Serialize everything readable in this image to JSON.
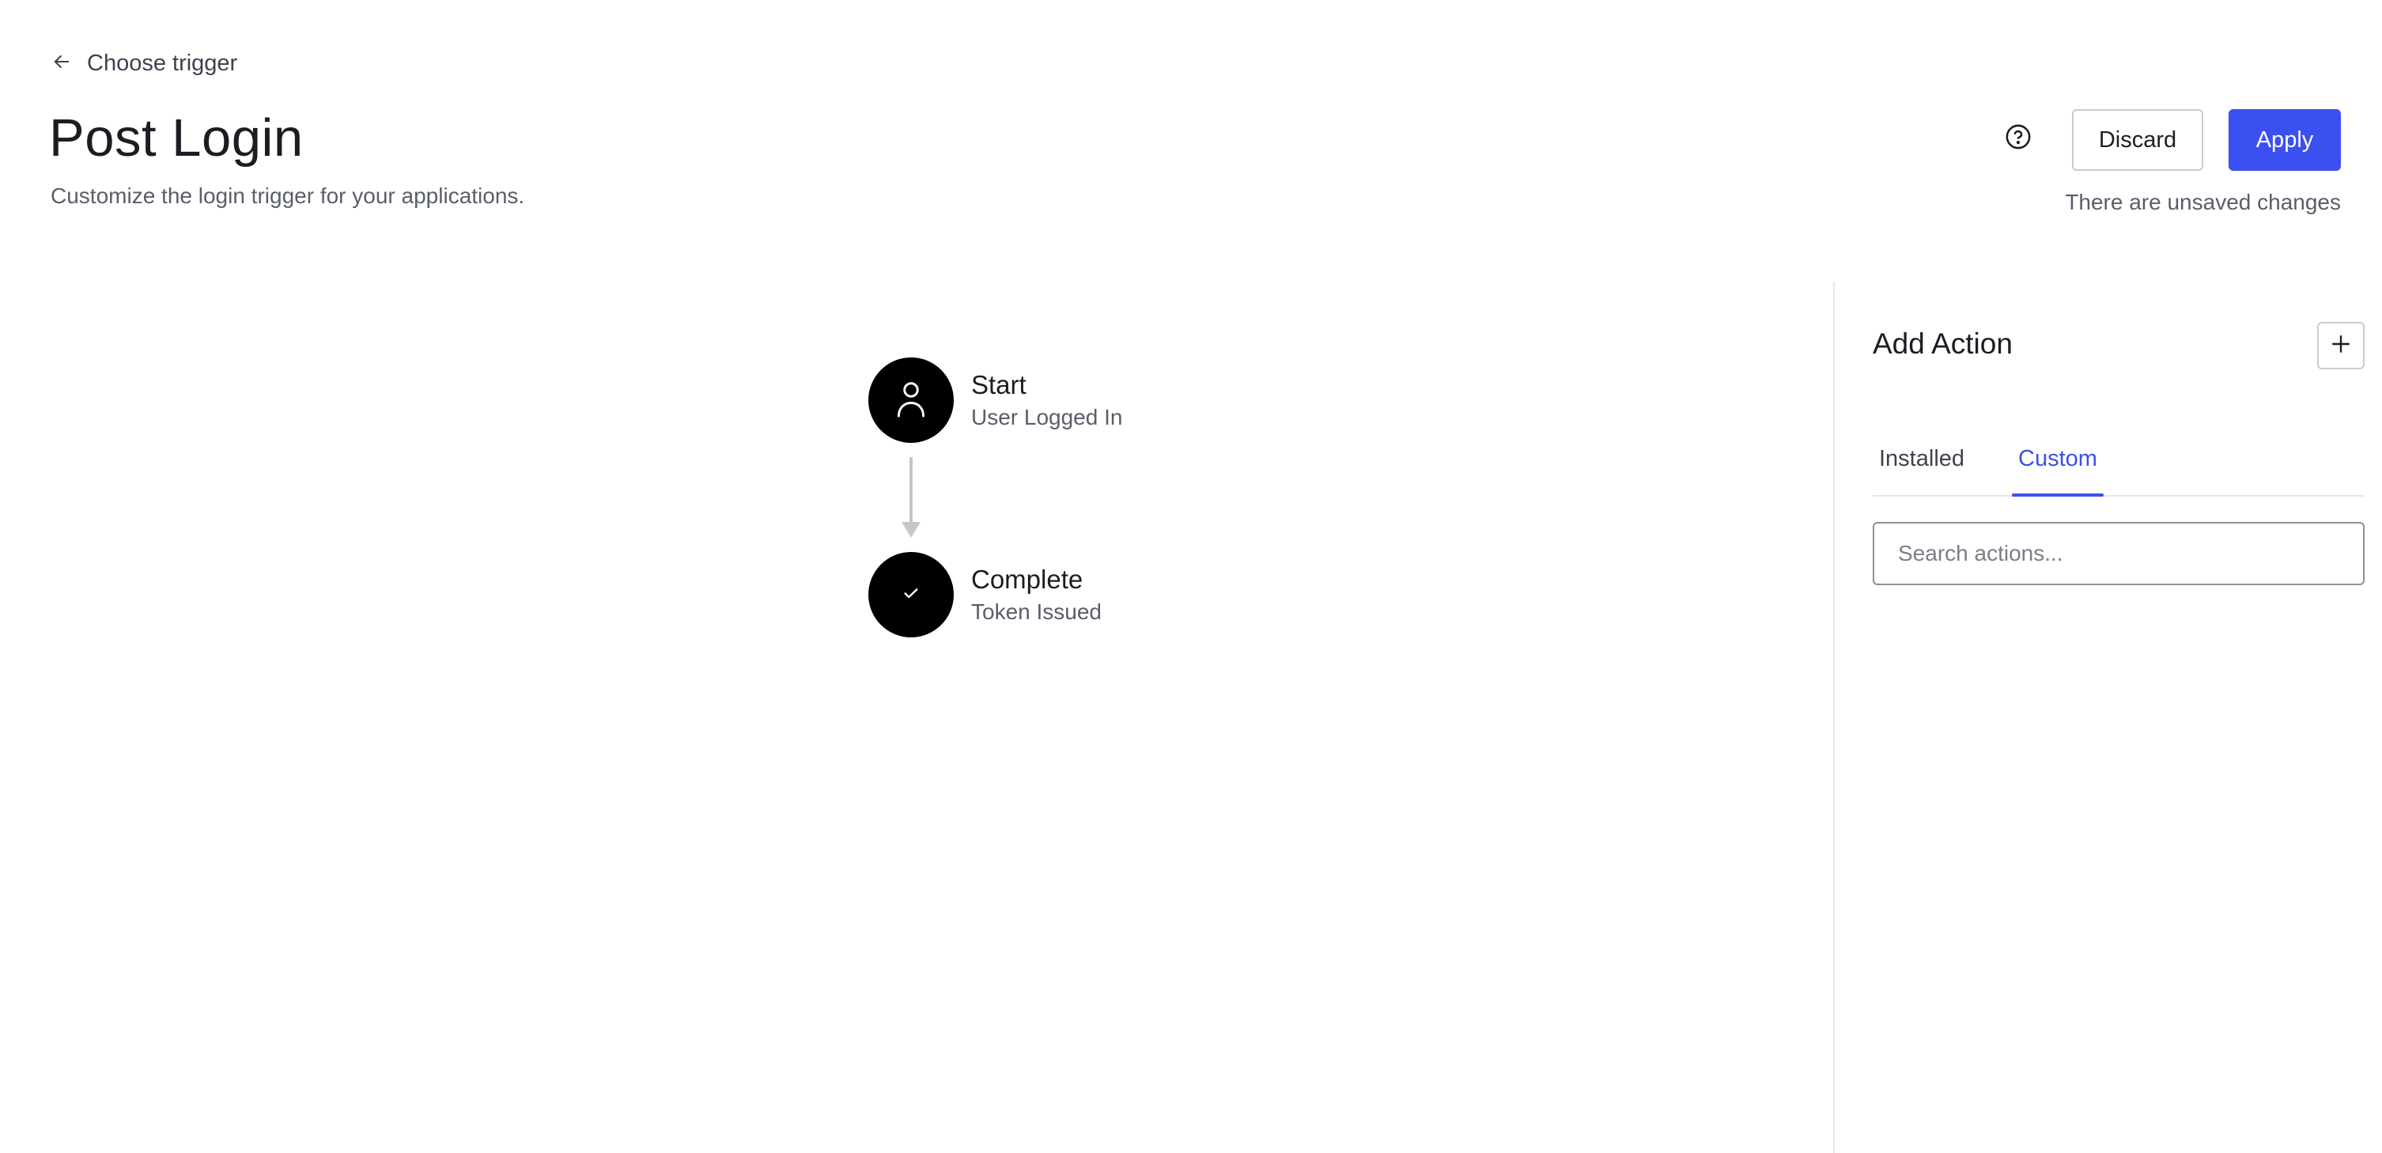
{
  "header": {
    "back_label": "Choose trigger",
    "title": "Post Login",
    "subtitle": "Customize the login trigger for your applications.",
    "discard_label": "Discard",
    "apply_label": "Apply",
    "unsaved_note": "There are unsaved changes",
    "help_icon": "help-circle-icon"
  },
  "flow": {
    "nodes": [
      {
        "title": "Start",
        "subtitle": "User Logged In",
        "icon": "user-icon"
      },
      {
        "title": "Complete",
        "subtitle": "Token Issued",
        "icon": "check-icon"
      }
    ]
  },
  "panel": {
    "title": "Add Action",
    "tabs": [
      {
        "label": "Installed",
        "active": false
      },
      {
        "label": "Custom",
        "active": true
      }
    ],
    "search_placeholder": "Search actions...",
    "search_value": ""
  },
  "colors": {
    "accent": "#3c4ff0",
    "node_fill": "#000000",
    "text_primary": "#1b1d23",
    "text_secondary": "#5a5e6b",
    "border": "#c9cbd3"
  }
}
